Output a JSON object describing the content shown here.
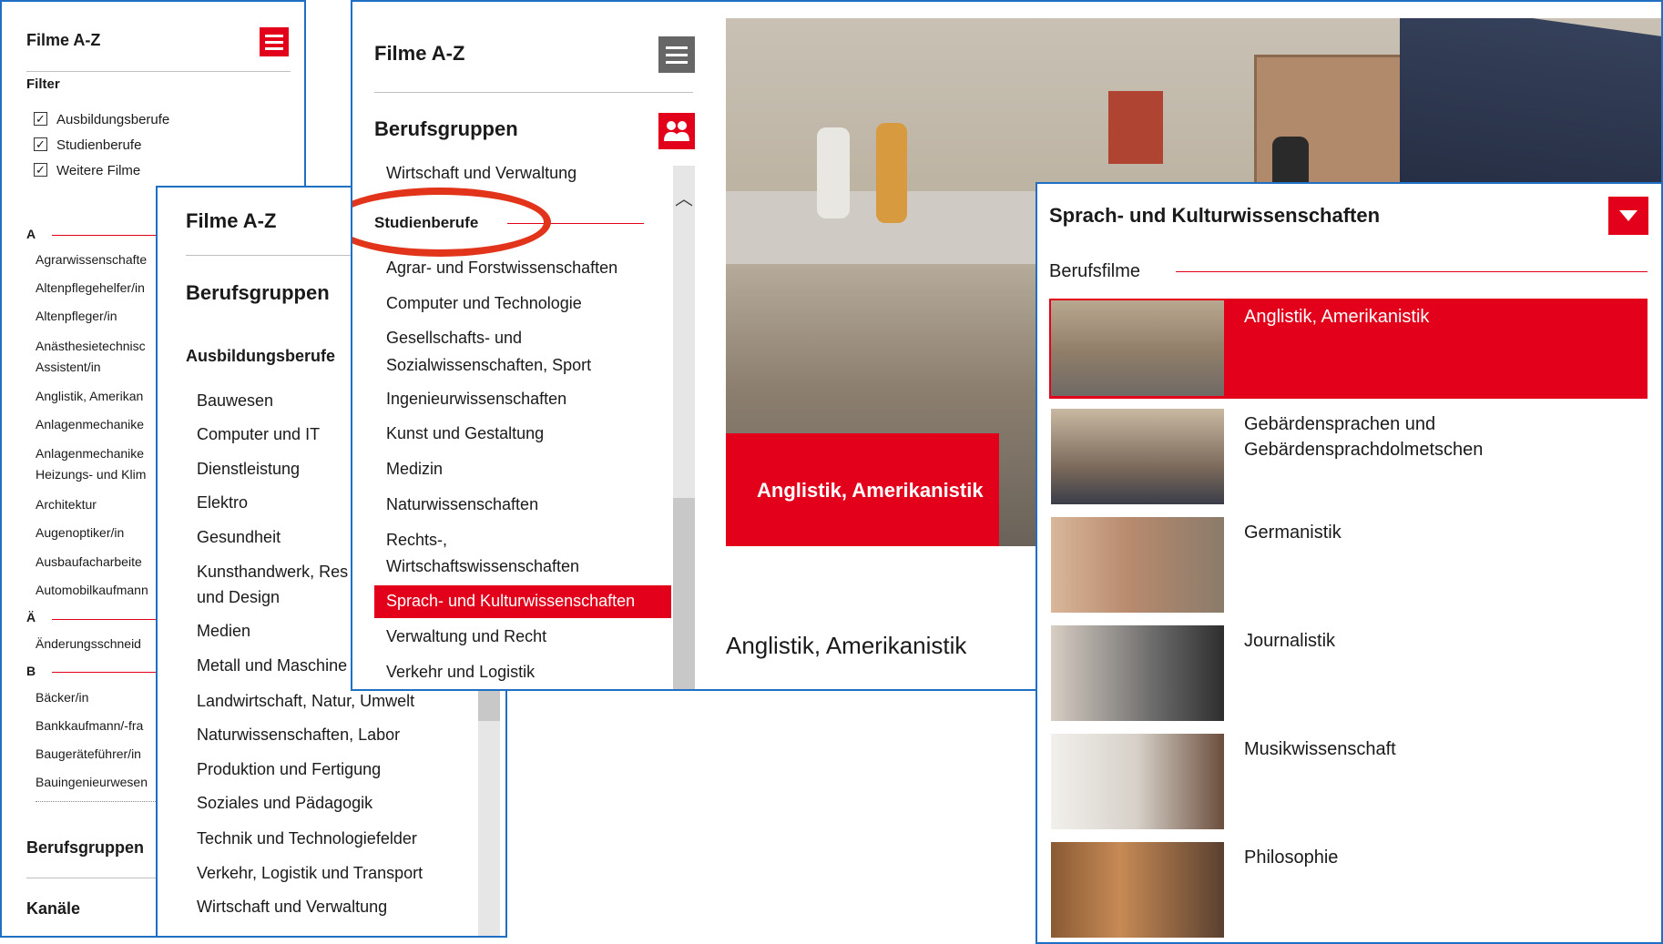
{
  "panel1": {
    "title": "Filme A-Z",
    "filter_label": "Filter",
    "filters": [
      {
        "label": "Ausbildungsberufe",
        "checked": true
      },
      {
        "label": "Studienberufe",
        "checked": true
      },
      {
        "label": "Weitere Filme",
        "checked": true
      }
    ],
    "letter_a": "A",
    "items_a": [
      "Agrarwissenschafte",
      "Altenpflegehelfer/in",
      "Altenpfleger/in",
      "Anästhesietechnisc",
      "Assistent/in",
      "Anglistik, Amerikan",
      "Anlagenmechanike",
      "Anlagenmechanike",
      "Heizungs- und Klim",
      "Architektur",
      "Augenoptiker/in",
      "Ausbaufacharbeite",
      "Automobilkaufmann"
    ],
    "letter_ae": "Ä",
    "items_ae": [
      "Änderungsschneid"
    ],
    "letter_b": "B",
    "items_b": [
      "Bäcker/in",
      "Bankkaufmann/-fra",
      "Baugeräteführer/in",
      "Bauingenieurwesen"
    ],
    "section_berufsgruppen": "Berufsgruppen",
    "section_kanaele": "Kanäle"
  },
  "panel2": {
    "title": "Filme A-Z",
    "section": "Berufsgruppen",
    "subsection": "Ausbildungsberufe",
    "items": [
      "Bauwesen",
      "Computer und IT",
      "Dienstleistung",
      "Elektro",
      "Gesundheit",
      "Kunsthandwerk, Res",
      "und Design",
      "Medien",
      "Metall und Maschine",
      "Landwirtschaft, Natur, Umwelt",
      "Naturwissenschaften, Labor",
      "Produktion und Fertigung",
      "Soziales und Pädagogik",
      "Technik und Technologiefelder",
      "Verkehr, Logistik und Transport",
      "Wirtschaft und Verwaltung"
    ]
  },
  "panel3": {
    "title": "Filme A-Z",
    "section": "Berufsgruppen",
    "first_item": "Wirtschaft und Verwaltung",
    "subsection": "Studienberufe",
    "items": [
      "Agrar- und Forstwissenschaften",
      "Computer und Technologie",
      "Gesellschafts- und",
      "Sozialwissenschaften, Sport",
      "Ingenieurwissenschaften",
      "Kunst und Gestaltung",
      "Medizin",
      "Naturwissenschaften",
      "Rechts-,",
      "Wirtschaftswissenschaften",
      "Sprach- und Kulturwissenschaften",
      "Verwaltung und Recht",
      "Verkehr und Logistik"
    ],
    "active_item": "Sprach- und Kulturwissenschaften",
    "video_caption": "Anglistik, Amerikanistik",
    "video_title": "Anglistik, Amerikanistik"
  },
  "panel4": {
    "title": "Sprach- und Kulturwissenschaften",
    "subsection": "Berufsfilme",
    "films": [
      "Anglistik, Amerikanistik",
      "Gebärdensprachen und",
      "Gebärdensprachdolmetschen",
      "Germanistik",
      "Journalistik",
      "Musikwissenschaft",
      "Philosophie"
    ]
  },
  "colors": {
    "accent": "#e2001a",
    "frame": "#1f6fc5"
  },
  "icons": {
    "menu": "hamburger-icon",
    "group": "people-icon",
    "collapse": "chevron-down-icon",
    "scroll_up": "chevron-up-icon",
    "check": "checkmark-icon"
  }
}
